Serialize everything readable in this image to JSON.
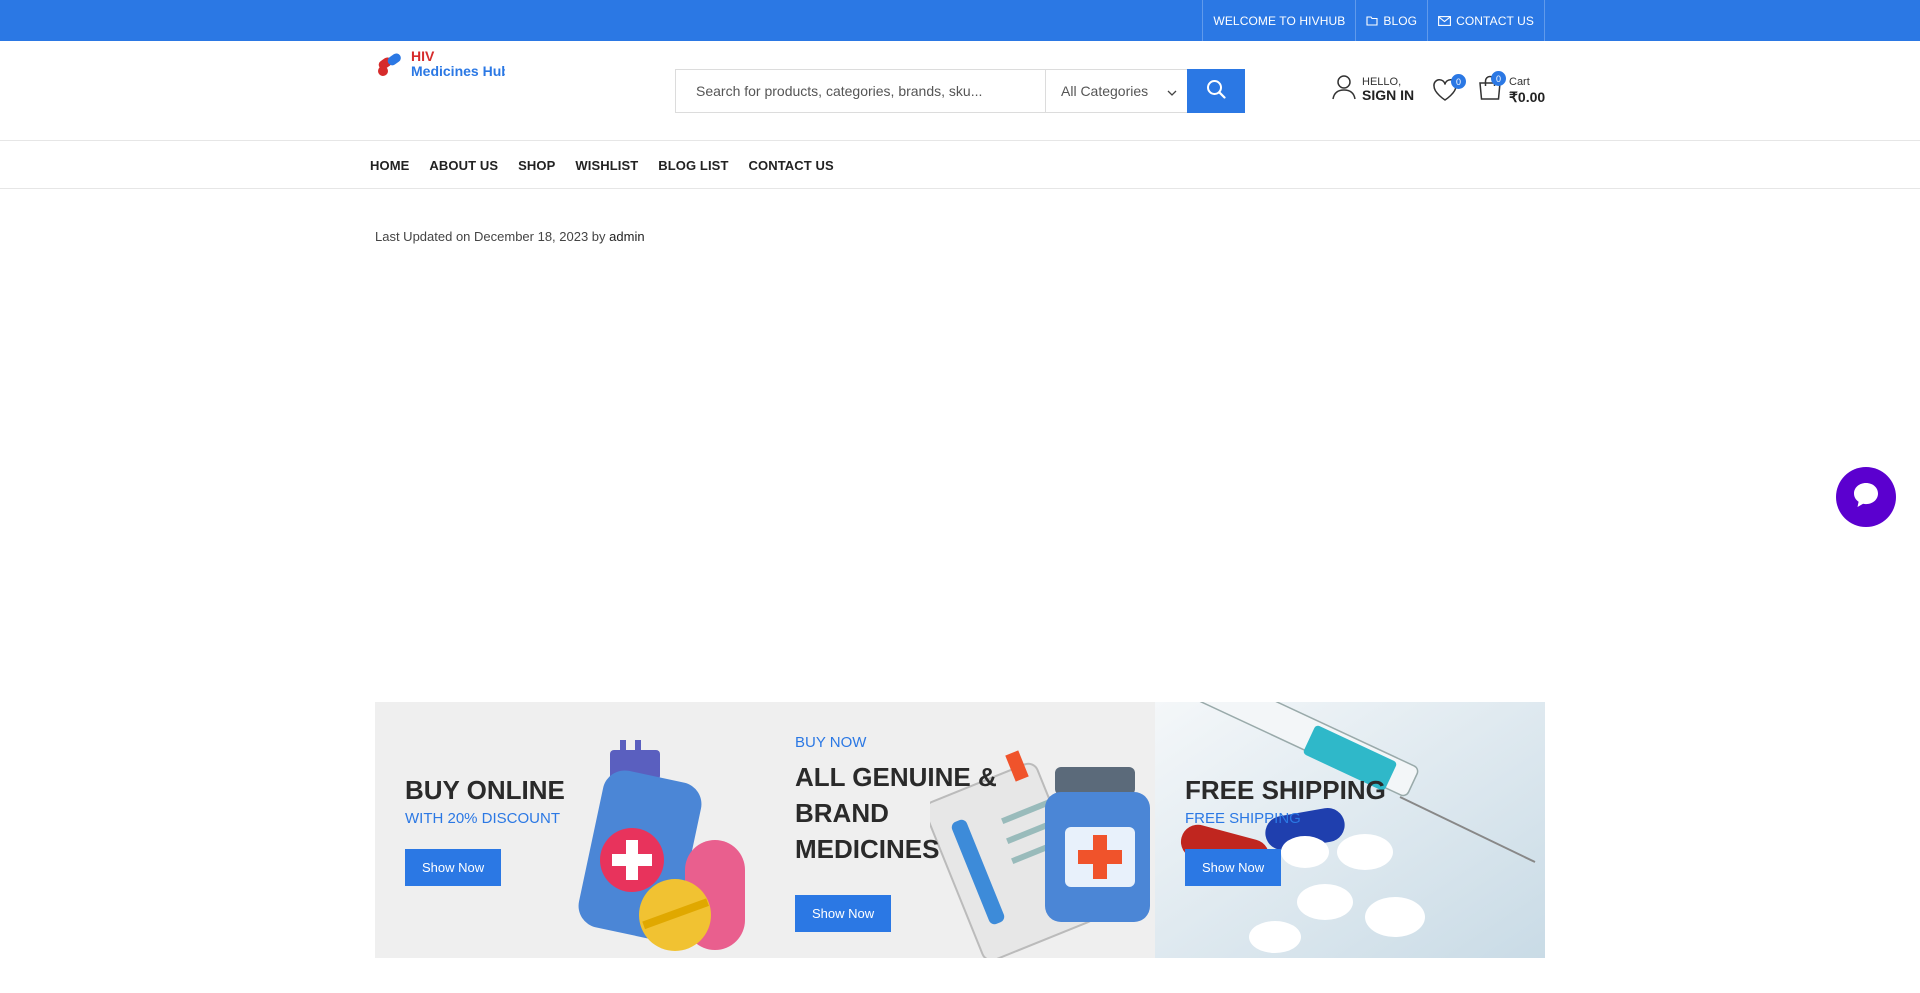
{
  "topbar": {
    "welcome": "WELCOME TO HIVHUB",
    "blog": "BLOG",
    "contact": "CONTACT US"
  },
  "header": {
    "logo_line1": "HIV",
    "logo_line2": "Medicines Hub",
    "search_placeholder": "Search for products, categories, brands, sku...",
    "category_selected": "All Categories",
    "account_hello": "HELLO,",
    "account_signin": "SIGN IN",
    "wishlist_count": "0",
    "cart_count": "0",
    "cart_label": "Cart",
    "cart_total": "₹0.00"
  },
  "nav": {
    "items": [
      "HOME",
      "ABOUT US",
      "SHOP",
      "WISHLIST",
      "BLOG LIST",
      "CONTACT US"
    ]
  },
  "meta": {
    "updated_prefix": "Last Updated on December 18, 2023 by",
    "author": "admin"
  },
  "banners": [
    {
      "pre": "",
      "title": "BUY ONLINE",
      "sub": "WITH 20% DISCOUNT",
      "button": "Show Now"
    },
    {
      "pre": "BUY NOW",
      "title": "ALL GENUINE & BRAND MEDICINES",
      "sub": "",
      "button": "Show Now"
    },
    {
      "pre": "",
      "title": "FREE SHIPPING",
      "sub": "FREE SHIPPING",
      "button": "Show Now"
    }
  ],
  "colors": {
    "primary": "#2b78e4",
    "chat": "#5b00cf",
    "banner_bg": "#efefef"
  }
}
